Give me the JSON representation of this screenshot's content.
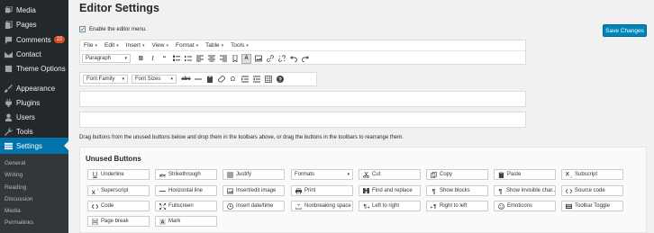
{
  "sidebar": {
    "items": [
      {
        "label": "Media",
        "icon": "media-icon"
      },
      {
        "label": "Pages",
        "icon": "pages-icon"
      },
      {
        "label": "Comments",
        "icon": "comments-icon",
        "badge": "22"
      },
      {
        "label": "Contact",
        "icon": "contact-icon"
      },
      {
        "label": "Theme Options",
        "icon": "theme-options-icon"
      },
      {
        "label": "Appearance",
        "icon": "appearance-icon"
      },
      {
        "label": "Plugins",
        "icon": "plugins-icon"
      },
      {
        "label": "Users",
        "icon": "users-icon"
      },
      {
        "label": "Tools",
        "icon": "tools-icon"
      },
      {
        "label": "Settings",
        "icon": "settings-icon",
        "active": true
      }
    ],
    "submenu": [
      "General",
      "Writing",
      "Reading",
      "Discussion",
      "Media",
      "Permalinks"
    ]
  },
  "page": {
    "title": "Editor Settings",
    "save_label": "Save Changes",
    "enable_label": "Enable the editor menu.",
    "enable_checked": true,
    "instructions": "Drag buttons from the unused buttons below and drop them in the toolbars above, or drag the buttons in the toolbars to rearrange them."
  },
  "editor": {
    "menubar": [
      "File",
      "Edit",
      "Insert",
      "View",
      "Format",
      "Table",
      "Tools"
    ],
    "toolbar1": {
      "block_select": "Paragraph",
      "buttons": [
        "bold-icon",
        "italic-icon",
        "blockquote-icon",
        "bullet-list-icon",
        "numbered-list-icon",
        "align-left-icon",
        "align-center-icon",
        "align-right-icon",
        "bookmark-icon",
        "text-color-icon",
        "image-icon",
        "link-icon",
        "unlink-icon",
        "undo-icon",
        "redo-icon"
      ]
    },
    "toolbar2": {
      "font_family": "Font Family",
      "font_sizes": "Font Sizes",
      "buttons": [
        "strikethrough-icon",
        "horizontal-rule-icon",
        "paste-text-icon",
        "eraser-icon",
        "omega-icon",
        "indent-icon",
        "outdent-icon",
        "table-icon",
        "help-icon"
      ]
    }
  },
  "unused": {
    "title": "Unused Buttons",
    "buttons": [
      {
        "label": "Underline",
        "icon": "underline-icon"
      },
      {
        "label": "Strikethrough",
        "icon": "strikethrough-icon"
      },
      {
        "label": "Justify",
        "icon": "justify-icon"
      },
      {
        "label": "Formats",
        "icon": "",
        "select": true
      },
      {
        "label": "Cut",
        "icon": "cut-icon"
      },
      {
        "label": "Copy",
        "icon": "copy-icon"
      },
      {
        "label": "Paste",
        "icon": "paste-icon"
      },
      {
        "label": "Subscript",
        "icon": "subscript-icon"
      },
      {
        "label": "Superscript",
        "icon": "superscript-icon"
      },
      {
        "label": "Horizontal line",
        "icon": "horizontal-line-icon"
      },
      {
        "label": "Insert/edit image",
        "icon": "image-icon"
      },
      {
        "label": "Print",
        "icon": "print-icon"
      },
      {
        "label": "Find and replace",
        "icon": "find-replace-icon"
      },
      {
        "label": "Show blocks",
        "icon": "show-blocks-icon"
      },
      {
        "label": "Show invisible char...",
        "icon": "invisible-chars-icon"
      },
      {
        "label": "Source code",
        "icon": "source-code-icon"
      },
      {
        "label": "Code",
        "icon": "code-icon"
      },
      {
        "label": "Fullscreen",
        "icon": "fullscreen-icon"
      },
      {
        "label": "Insert date/time",
        "icon": "clock-icon"
      },
      {
        "label": "Nonbreaking space",
        "icon": "nbsp-icon"
      },
      {
        "label": "Left to right",
        "icon": "ltr-icon"
      },
      {
        "label": "Right to left",
        "icon": "rtl-icon"
      },
      {
        "label": "Emoticons",
        "icon": "emoticons-icon"
      },
      {
        "label": "Toolbar Toggle",
        "icon": "toolbar-toggle-icon"
      },
      {
        "label": "Page break",
        "icon": "page-break-icon"
      },
      {
        "label": "Mark",
        "icon": "mark-icon"
      }
    ]
  },
  "colors": {
    "sidebar_bg": "#23282d",
    "submenu_bg": "#32373c",
    "active_bg": "#0073aa",
    "primary_button": "#0085ba",
    "badge": "#d54e21"
  }
}
